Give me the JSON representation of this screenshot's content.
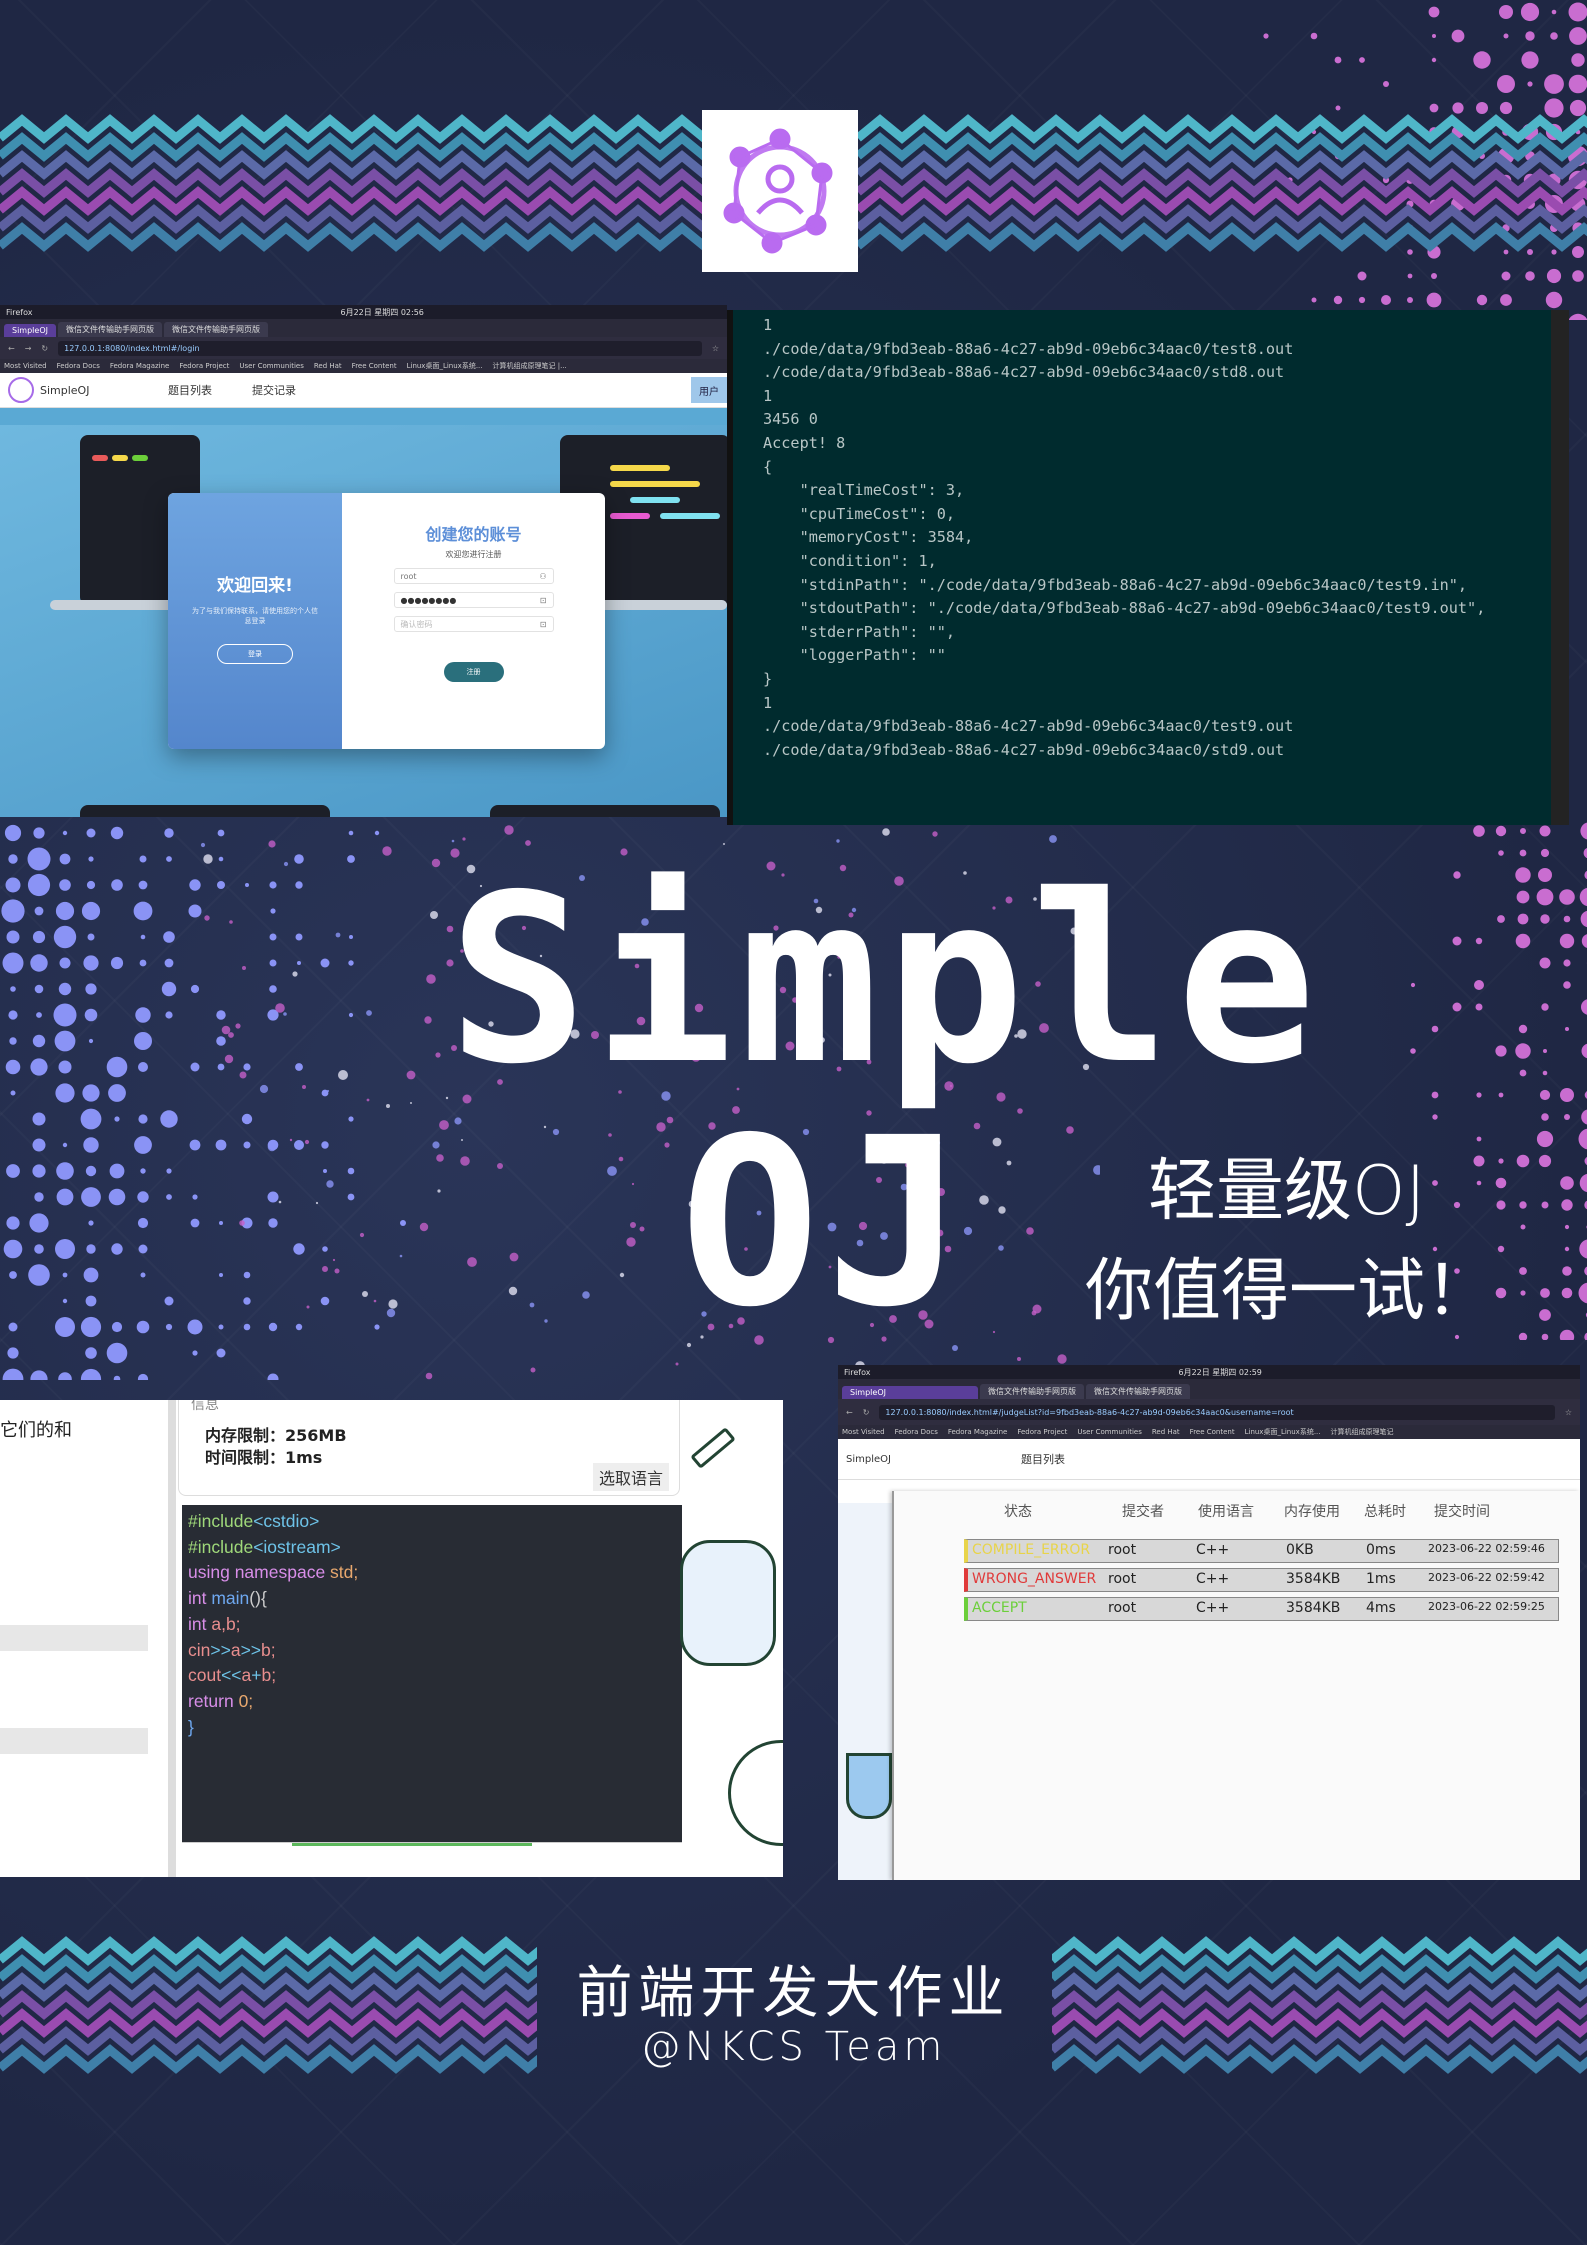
{
  "colors": {
    "background": "#232c4a",
    "accent_purple": "#c06bd8",
    "accent_blue": "#7f8cf0",
    "zigzag_teal": "#55c3d4",
    "terminal_bg": "#002b2e"
  },
  "logo": {
    "icon": "people-network-icon"
  },
  "login_screenshot": {
    "os_bar": {
      "app": "Firefox",
      "datetime": "6月22日 星期四 02:56"
    },
    "tabs": [
      "SimpleOJ",
      "微信文件传输助手网页版",
      "微信文件传输助手网页版"
    ],
    "url": "127.0.0.1:8080/index.html#/login",
    "bookmarks": [
      "Most Visited",
      "Fedora Docs",
      "Fedora Magazine",
      "Fedora Project",
      "User Communities",
      "Red Hat",
      "Free Content",
      "Linux桌面_Linux系统...",
      "计算机组成原理笔记 |..."
    ],
    "nav": {
      "brand": "SimpleOJ",
      "items": [
        "题目列表",
        "提交记录"
      ],
      "user": "用户"
    },
    "welcome": {
      "title": "欢迎回来!",
      "subtitle": "为了与我们保持联系，请使用您的个人信息登录",
      "button": "登录"
    },
    "register": {
      "title": "创建您的账号",
      "subtitle": "欢迎您进行注册",
      "username": "root",
      "password": "●●●●●●●●",
      "confirm_placeholder": "确认密码",
      "submit": "注册"
    }
  },
  "terminal": {
    "lines": [
      "1",
      "./code/data/9fbd3eab-88a6-4c27-ab9d-09eb6c34aac0/test8.out",
      "./code/data/9fbd3eab-88a6-4c27-ab9d-09eb6c34aac0/std8.out",
      "1",
      "3456 0",
      "Accept! 8",
      "{",
      "    \"realTimeCost\": 3,",
      "    \"cpuTimeCost\": 0,",
      "    \"memoryCost\": 3584,",
      "    \"condition\": 1,",
      "    \"stdinPath\": \"./code/data/9fbd3eab-88a6-4c27-ab9d-09eb6c34aac0/test9.in\",",
      "    \"stdoutPath\": \"./code/data/9fbd3eab-88a6-4c27-ab9d-09eb6c34aac0/test9.out\",",
      "    \"stderrPath\": \"\",",
      "    \"loggerPath\": \"\"",
      "}",
      "1",
      "./code/data/9fbd3eab-88a6-4c27-ab9d-09eb6c34aac0/test9.out",
      "./code/data/9fbd3eab-88a6-4c27-ab9d-09eb6c34aac0/std9.out"
    ]
  },
  "title": {
    "line1": "Simple",
    "line2": "OJ"
  },
  "slogan": {
    "line1": "轻量级OJ",
    "line2": "你值得一试！"
  },
  "editor_screenshot": {
    "side_text": "它们的和",
    "info_header": "信息",
    "memory_limit": "内存限制：256MB",
    "time_limit": "时间限制：1ms",
    "lang_button": "选取语言",
    "code": [
      [
        {
          "t": "#include",
          "c": "#9fd87a"
        },
        {
          "t": "<cstdio>",
          "c": "#6ec3e8"
        }
      ],
      [
        {
          "t": "#include",
          "c": "#9fd87a"
        },
        {
          "t": "<iostream>",
          "c": "#6ec3e8"
        }
      ],
      [
        {
          "t": "using namespace ",
          "c": "#d88ee8"
        },
        {
          "t": "std;",
          "c": "#e8a86e"
        }
      ],
      [
        {
          "t": "int ",
          "c": "#d88ee8"
        },
        {
          "t": "main",
          "c": "#6ea8f0"
        },
        {
          "t": "(){",
          "c": "#cccccc"
        }
      ],
      [
        {
          "t": "int ",
          "c": "#d88ee8"
        },
        {
          "t": "a,b;",
          "c": "#e88e8e"
        }
      ],
      [
        {
          "t": "cin",
          "c": "#e88e8e"
        },
        {
          "t": ">>",
          "c": "#6ec3e8"
        },
        {
          "t": "a",
          "c": "#e88e8e"
        },
        {
          "t": ">>",
          "c": "#6ec3e8"
        },
        {
          "t": "b;",
          "c": "#e88e8e"
        }
      ],
      [
        {
          "t": "cout",
          "c": "#e88e8e"
        },
        {
          "t": "<<",
          "c": "#6ec3e8"
        },
        {
          "t": "a",
          "c": "#e88e8e"
        },
        {
          "t": "+",
          "c": "#6ec3e8"
        },
        {
          "t": "b;",
          "c": "#e88e8e"
        }
      ],
      [
        {
          "t": "return ",
          "c": "#d88ee8"
        },
        {
          "t": "0;",
          "c": "#e8a86e"
        }
      ],
      [
        {
          "t": "}",
          "c": "#6ea8f0"
        }
      ]
    ]
  },
  "judge_screenshot": {
    "os_bar": {
      "app": "Firefox",
      "datetime": "6月22日 星期四 02:59"
    },
    "tabs": [
      "SimpleOJ",
      "微信文件传输助手网页版",
      "微信文件传输助手网页版"
    ],
    "url": "127.0.0.1:8080/index.html#/judgeList?id=9fbd3eab-88a6-4c27-ab9d-09eb6c34aac0&username=root",
    "bookmarks": [
      "Most Visited",
      "Fedora Docs",
      "Fedora Magazine",
      "Fedora Project",
      "User Communities",
      "Red Hat",
      "Free Content",
      "Linux桌面_Linux系统...",
      "计算机组成原理笔记"
    ],
    "nav": {
      "brand": "SimpleOJ",
      "items": [
        "题目列表"
      ]
    },
    "columns": [
      "状态",
      "提交者",
      "使用语言",
      "内存使用",
      "总耗时",
      "提交时间"
    ],
    "rows": [
      {
        "status": "COMPILE_ERROR",
        "user": "root",
        "lang": "C++",
        "mem": "0KB",
        "time": "0ms",
        "submitted": "2023-06-22 02:59:46",
        "color": "#e8d44a"
      },
      {
        "status": "WRONG_ANSWER",
        "user": "root",
        "lang": "C++",
        "mem": "3584KB",
        "time": "1ms",
        "submitted": "2023-06-22 02:59:42",
        "color": "#e03a3a"
      },
      {
        "status": "ACCEPT",
        "user": "root",
        "lang": "C++",
        "mem": "3584KB",
        "time": "4ms",
        "submitted": "2023-06-22 02:59:25",
        "color": "#6ccf3a"
      }
    ]
  },
  "footer": {
    "title": "前端开发大作业",
    "team": "@NKCS Team"
  }
}
